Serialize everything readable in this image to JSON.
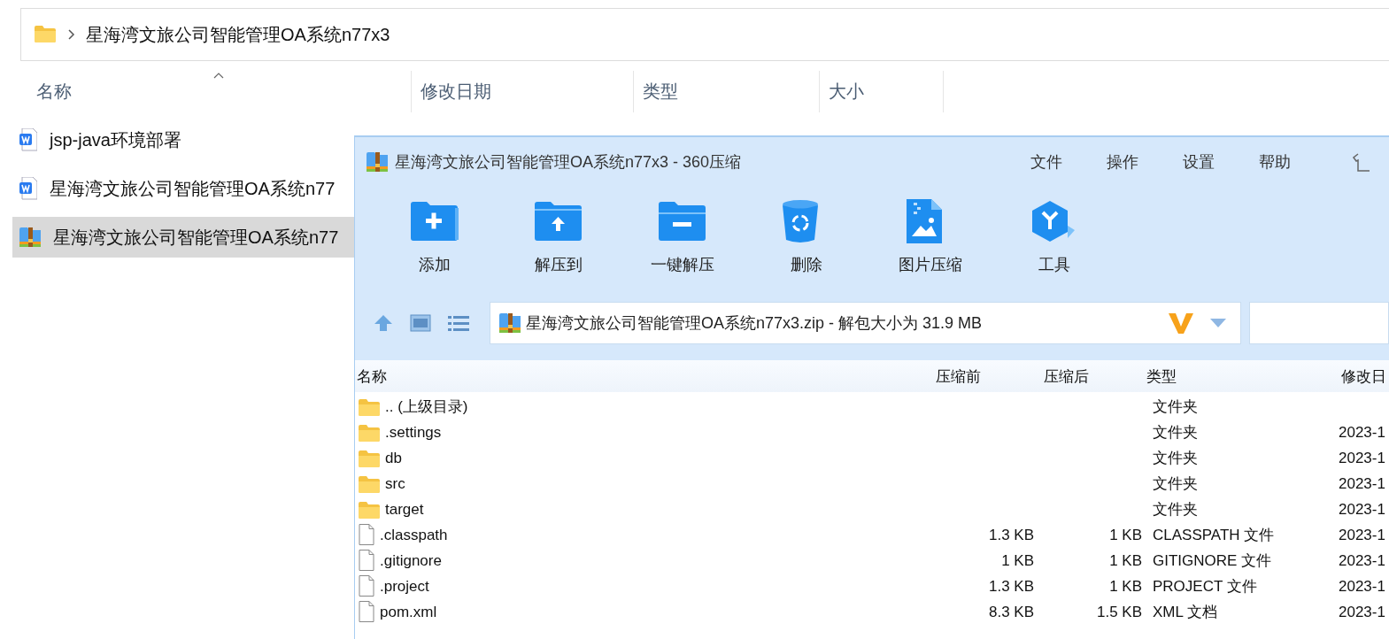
{
  "explorer": {
    "breadcrumb": "星海湾文旅公司智能管理OA系统n77x3",
    "columns": [
      {
        "label": "名称",
        "sorted": true
      },
      {
        "label": "修改日期",
        "sorted": false
      },
      {
        "label": "类型",
        "sorted": false
      },
      {
        "label": "大小",
        "sorted": false
      }
    ],
    "files": [
      {
        "name": "jsp-java环境部署",
        "kind": "doc",
        "selected": false
      },
      {
        "name": "星海湾文旅公司智能管理OA系统n77",
        "kind": "doc",
        "selected": false
      },
      {
        "name": "星海湾文旅公司智能管理OA系统n77",
        "kind": "archive",
        "selected": true
      }
    ]
  },
  "archiver": {
    "title": "星海湾文旅公司智能管理OA系统n77x3 - 360压缩",
    "menu": [
      "文件",
      "操作",
      "设置",
      "帮助"
    ],
    "tools": [
      {
        "label": "添加",
        "kind": "add"
      },
      {
        "label": "解压到",
        "kind": "extract"
      },
      {
        "label": "一键解压",
        "kind": "oneclick"
      },
      {
        "label": "删除",
        "kind": "delete"
      },
      {
        "label": "图片压缩",
        "kind": "image"
      },
      {
        "label": "工具",
        "kind": "tools"
      }
    ],
    "path": "星海湾文旅公司智能管理OA系统n77x3.zip - 解包大小为 31.9 MB",
    "columns": [
      "名称",
      "压缩前",
      "压缩后",
      "类型",
      "修改日"
    ],
    "rows": [
      {
        "name": ".. (上级目录)",
        "kind": "folder",
        "type": "文件夹"
      },
      {
        "name": ".settings",
        "kind": "folder",
        "type": "文件夹",
        "modified": "2023-1"
      },
      {
        "name": "db",
        "kind": "folder",
        "type": "文件夹",
        "modified": "2023-1"
      },
      {
        "name": "src",
        "kind": "folder",
        "type": "文件夹",
        "modified": "2023-1"
      },
      {
        "name": "target",
        "kind": "folder",
        "type": "文件夹",
        "modified": "2023-1"
      },
      {
        "name": ".classpath",
        "kind": "file",
        "original": "1.3 KB",
        "compressed": "1 KB",
        "type": "CLASSPATH 文件",
        "modified": "2023-1"
      },
      {
        "name": ".gitignore",
        "kind": "file",
        "original": "1 KB",
        "compressed": "1 KB",
        "type": "GITIGNORE 文件",
        "modified": "2023-1"
      },
      {
        "name": ".project",
        "kind": "file",
        "original": "1.3 KB",
        "compressed": "1 KB",
        "type": "PROJECT 文件",
        "modified": "2023-1"
      },
      {
        "name": "pom.xml",
        "kind": "file",
        "original": "8.3 KB",
        "compressed": "1.5 KB",
        "type": "XML 文档",
        "modified": "2023-1"
      }
    ]
  }
}
